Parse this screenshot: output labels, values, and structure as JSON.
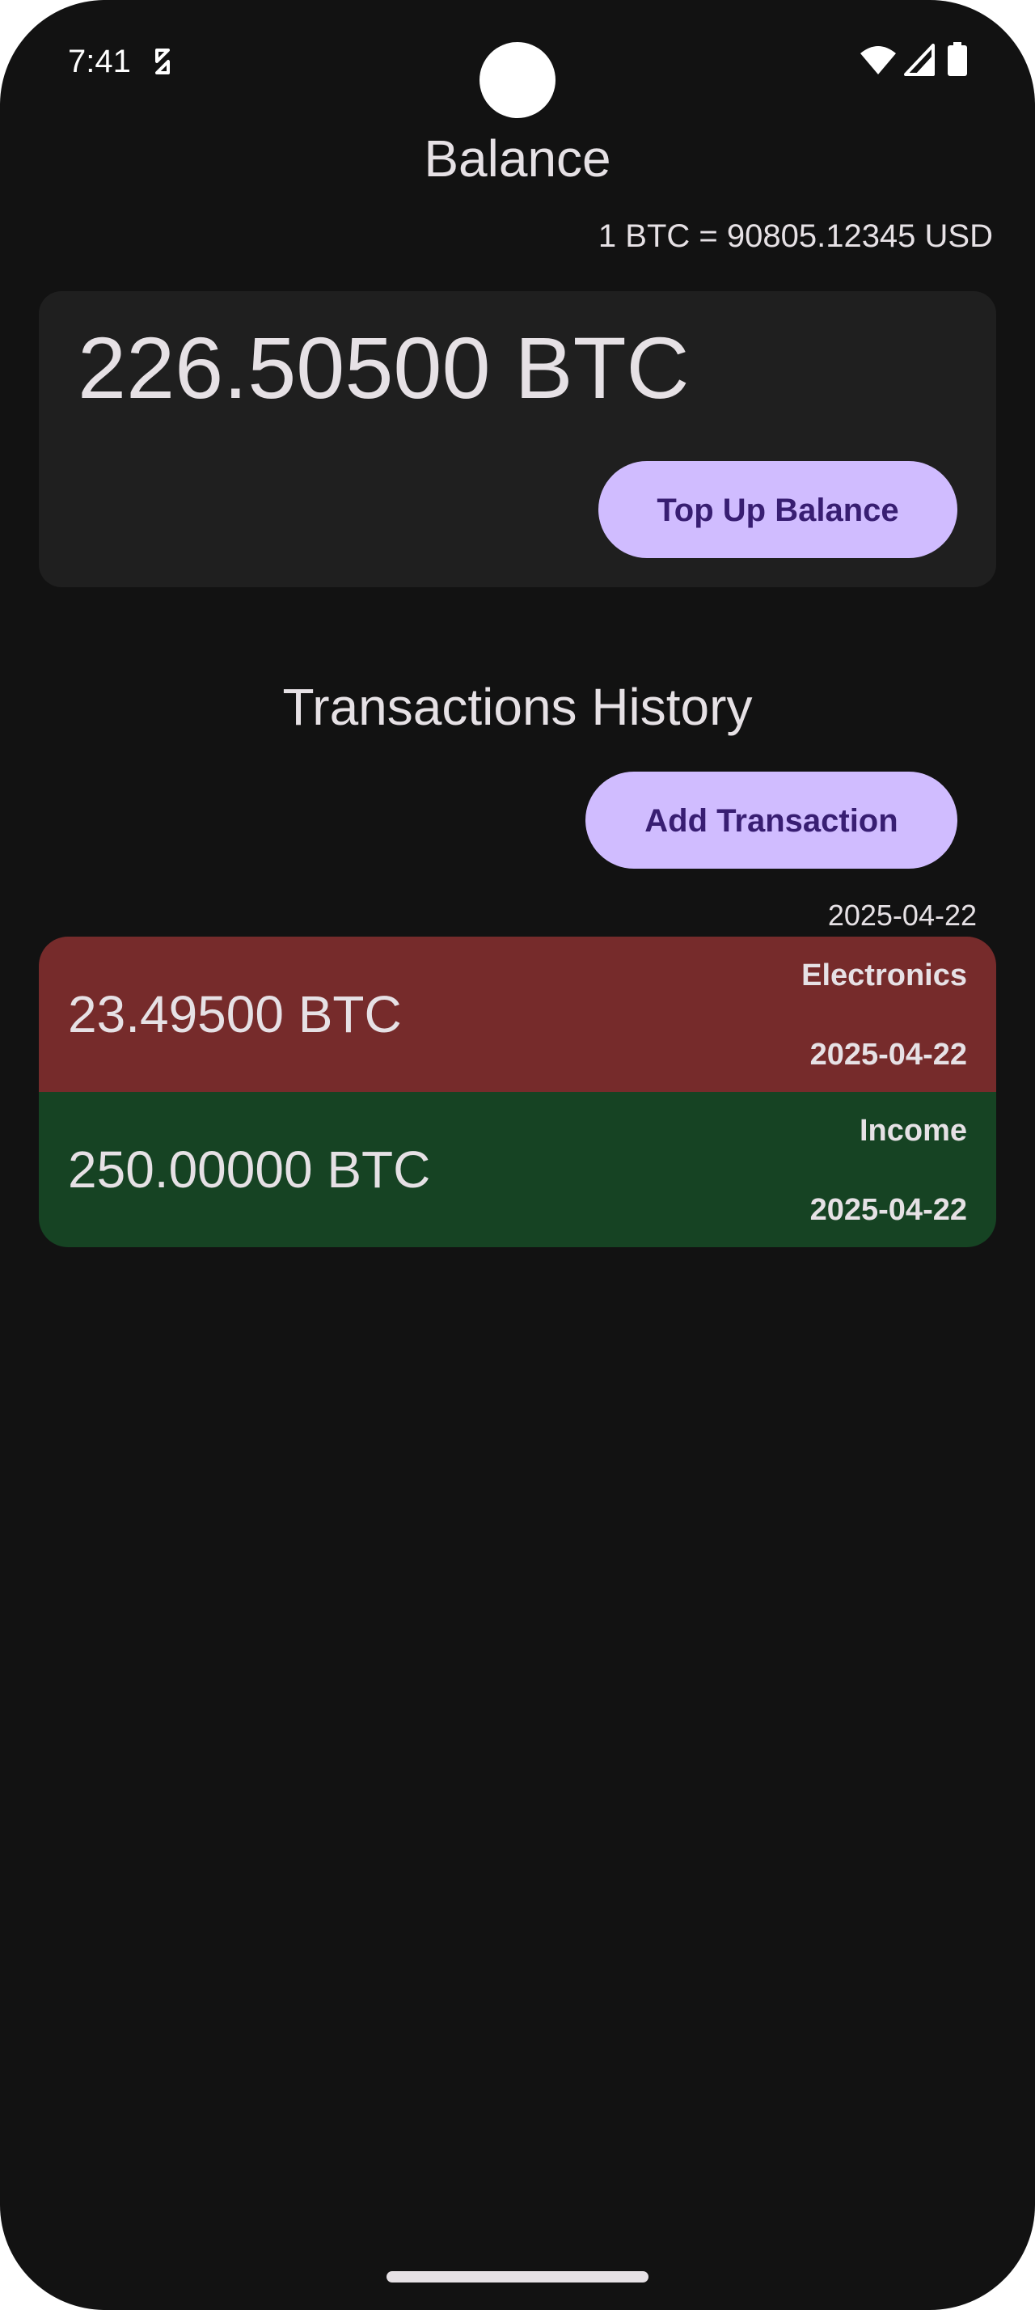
{
  "status_bar": {
    "time": "7:41",
    "icons": [
      "sync-icon",
      "wifi-icon",
      "signal-icon",
      "battery-icon"
    ]
  },
  "header": {
    "title": "Balance",
    "exchange_rate": "1 BTC = 90805.12345 USD"
  },
  "balance_card": {
    "amount": "226.50500 BTC",
    "top_up_label": "Top Up Balance"
  },
  "transactions": {
    "title": "Transactions History",
    "add_label": "Add Transaction",
    "groups": [
      {
        "date": "2025-04-22",
        "items": [
          {
            "amount": "23.49500 BTC",
            "category": "Electronics",
            "date": "2025-04-22",
            "type": "expense"
          },
          {
            "amount": "250.00000 BTC",
            "category": "Income",
            "date": "2025-04-22",
            "type": "income"
          }
        ]
      }
    ]
  },
  "colors": {
    "background": "#121212",
    "card": "#1f1f1f",
    "accent": "#d0bcff",
    "on_accent": "#381e72",
    "expense": "#762b2b",
    "income": "#164323",
    "text": "#e6e1e5"
  }
}
